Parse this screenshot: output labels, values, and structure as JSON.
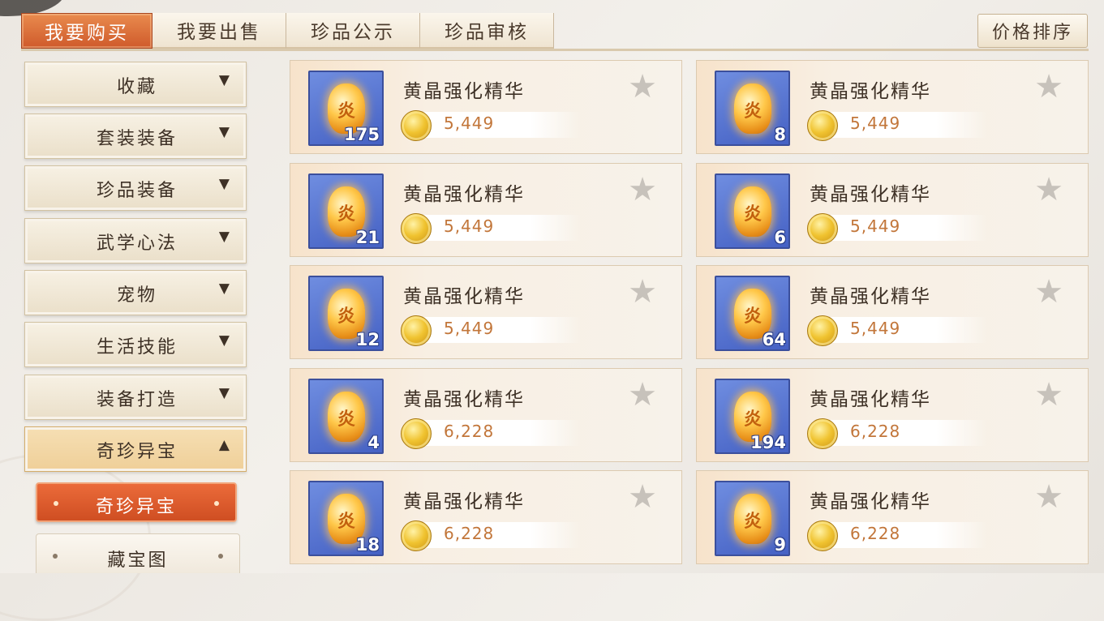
{
  "colors": {
    "accent_tab": "#d8663a",
    "price_text": "#c2763a",
    "item_icon_bg": "#4a67c8",
    "card_bg": "#f6efe4"
  },
  "tabs": [
    {
      "label": "我要购买",
      "active": true
    },
    {
      "label": "我要出售",
      "active": false
    },
    {
      "label": "珍品公示",
      "active": false
    },
    {
      "label": "珍品审核",
      "active": false
    }
  ],
  "sort_button": {
    "label": "价格排序"
  },
  "sidebar": {
    "categories": [
      {
        "label": "收藏",
        "arrow": "▼",
        "icon": "chevron-down-icon"
      },
      {
        "label": "套装装备",
        "arrow": "▼",
        "icon": "chevron-down-icon"
      },
      {
        "label": "珍品装备",
        "arrow": "▼",
        "icon": "chevron-down-icon"
      },
      {
        "label": "武学心法",
        "arrow": "▼",
        "icon": "chevron-down-icon"
      },
      {
        "label": "宠物",
        "arrow": "▼",
        "icon": "chevron-down-icon"
      },
      {
        "label": "生活技能",
        "arrow": "▼",
        "icon": "chevron-down-icon"
      },
      {
        "label": "装备打造",
        "arrow": "▼",
        "icon": "chevron-down-icon"
      },
      {
        "label": "奇珍异宝",
        "arrow": "▲",
        "icon": "chevron-up-icon",
        "expanded": true
      }
    ],
    "subitems": [
      {
        "label": "奇珍异宝",
        "active": true
      },
      {
        "label": "藏宝图",
        "active": false
      }
    ]
  },
  "items": [
    {
      "name": "黄晶强化精华",
      "price": "5,449",
      "quantity": "175",
      "icon": "yellow-crystal-icon",
      "favorite": false
    },
    {
      "name": "黄晶强化精华",
      "price": "5,449",
      "quantity": "8",
      "icon": "yellow-crystal-icon",
      "favorite": false
    },
    {
      "name": "黄晶强化精华",
      "price": "5,449",
      "quantity": "21",
      "icon": "yellow-crystal-icon",
      "favorite": false
    },
    {
      "name": "黄晶强化精华",
      "price": "5,449",
      "quantity": "6",
      "icon": "yellow-crystal-icon",
      "favorite": false
    },
    {
      "name": "黄晶强化精华",
      "price": "5,449",
      "quantity": "12",
      "icon": "yellow-crystal-icon",
      "favorite": false
    },
    {
      "name": "黄晶强化精华",
      "price": "5,449",
      "quantity": "64",
      "icon": "yellow-crystal-icon",
      "favorite": false
    },
    {
      "name": "黄晶强化精华",
      "price": "6,228",
      "quantity": "4",
      "icon": "yellow-crystal-icon",
      "favorite": false
    },
    {
      "name": "黄晶强化精华",
      "price": "6,228",
      "quantity": "194",
      "icon": "yellow-crystal-icon",
      "favorite": false
    },
    {
      "name": "黄晶强化精华",
      "price": "6,228",
      "quantity": "18",
      "icon": "yellow-crystal-icon",
      "favorite": false
    },
    {
      "name": "黄晶强化精华",
      "price": "6,228",
      "quantity": "9",
      "icon": "yellow-crystal-icon",
      "favorite": false
    }
  ]
}
